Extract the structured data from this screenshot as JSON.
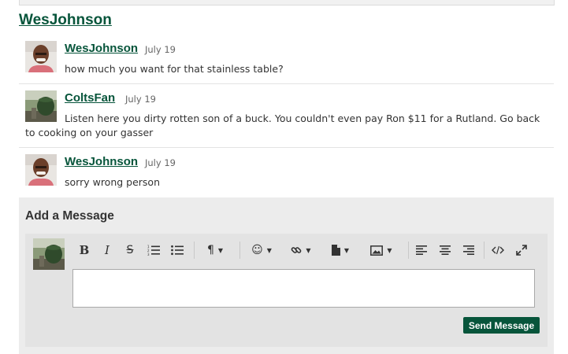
{
  "thread": {
    "title": "WesJohnson"
  },
  "messages": [
    {
      "username": "WesJohnson",
      "date": "July 19",
      "text": "how much you want for that stainless table?"
    },
    {
      "username": "ColtsFan",
      "date": "July 19",
      "text_line1": "Listen here you dirty rotten son of a buck. You couldn't even pay Ron $11 for a Rutland. Go back",
      "text_line2": "to cooking on your gasser"
    },
    {
      "username": "WesJohnson",
      "date": "July 19",
      "text": "sorry wrong person"
    }
  ],
  "compose": {
    "title": "Add a Message",
    "send_label": "Send Message",
    "toolbar": [
      "bold",
      "italic",
      "strikethrough",
      "ordered-list",
      "unordered-list",
      "paragraph",
      "emoji",
      "link",
      "file",
      "image",
      "align-left",
      "align-center",
      "align-right",
      "code-view",
      "fullscreen"
    ]
  },
  "colors": {
    "brand_green": "#07553b",
    "compose_bg": "#ececec"
  }
}
